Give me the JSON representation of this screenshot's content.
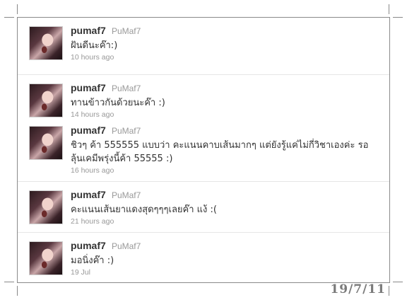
{
  "tweets": [
    {
      "screen_name": "pumaf7",
      "full_name": "PuMaf7",
      "text": "ฝันดีนะค๊า:)",
      "time": "10 hours ago"
    },
    {
      "screen_name": "pumaf7",
      "full_name": "PuMaf7",
      "text": "ทานข้าวกันด้วยนะค๊า :)",
      "time": "14 hours ago"
    },
    {
      "screen_name": "pumaf7",
      "full_name": "PuMaf7",
      "text_line1": "ชิวๆ ค้า 555555 แบบว่า คะแนนคาบเส้นมากๆ แต่ยังรู้แค่ไม่กี่วิชาเองค่ะ รอ",
      "text_line2": "ลุ้นเคมีพรุ่งนี้ค้า 55555 :)",
      "time": "16 hours ago"
    },
    {
      "screen_name": "pumaf7",
      "full_name": "PuMaf7",
      "text": "คะแนนเส้นยาแดงสุดๆๆๆเลยค๊า แง้ :(",
      "time": "21 hours ago"
    },
    {
      "screen_name": "pumaf7",
      "full_name": "PuMaf7",
      "text": "มอนิ่งค๊า :)",
      "time": "19 Jul"
    }
  ],
  "date_stamp": "19/7/11",
  "colors": {
    "border": "#8a8a8a",
    "separator": "#e6e6e6",
    "screen_name": "#333333",
    "meta": "#999999",
    "stamp": "#7a7a7a"
  }
}
